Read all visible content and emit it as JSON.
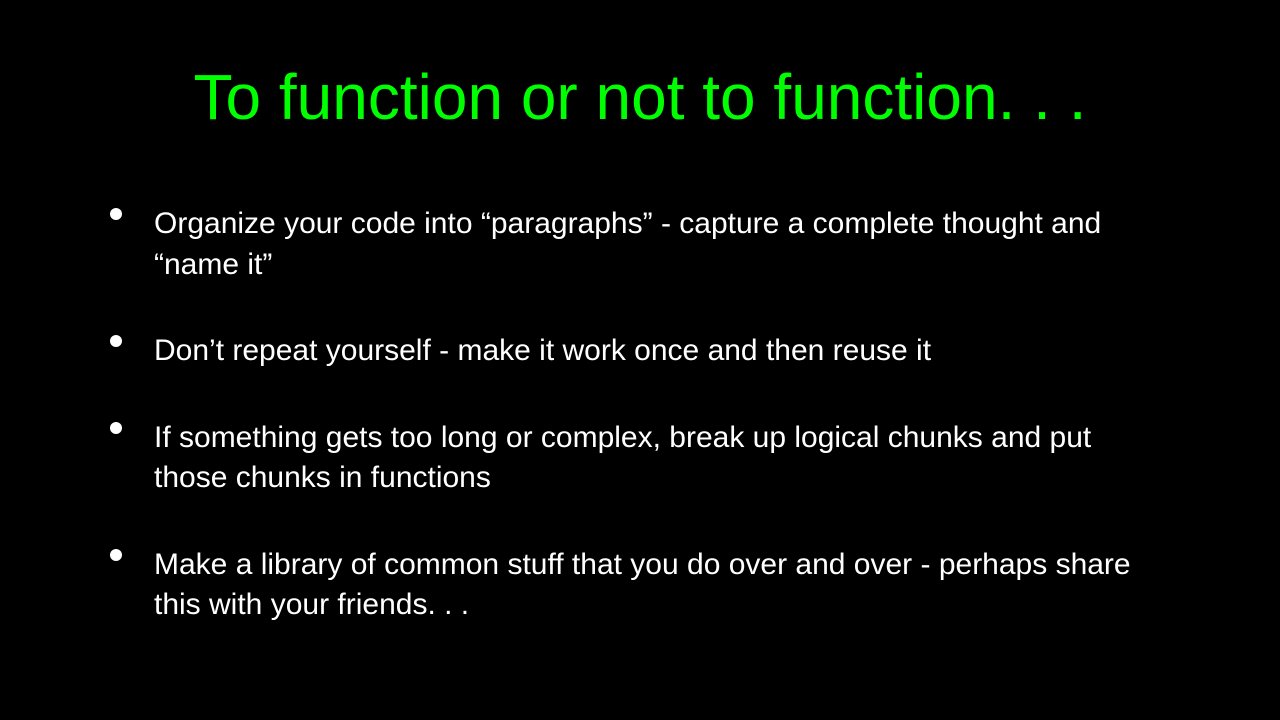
{
  "slide": {
    "title": "To function or not to function. . .",
    "bullets": [
      "Organize your code into “paragraphs” - capture a complete thought and “name it”",
      "Don’t repeat yourself - make it work once and then reuse it",
      "If something gets too long or complex, break up logical chunks and put those chunks in functions",
      "Make a library of common stuff that you do over and over - perhaps share this with your friends. . ."
    ]
  }
}
